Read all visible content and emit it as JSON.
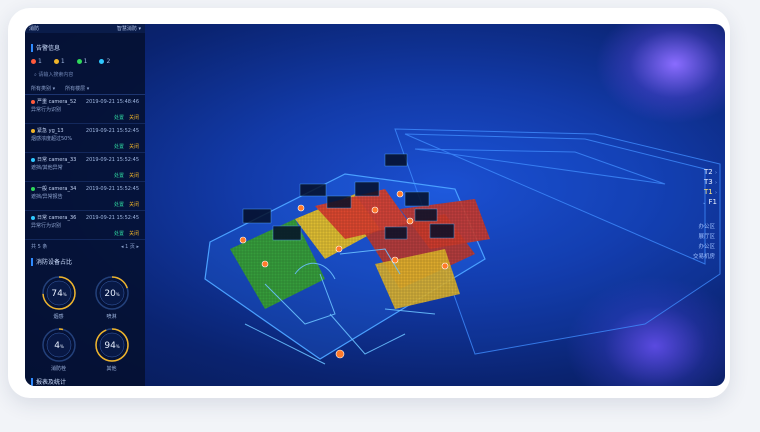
{
  "header": {
    "title": "消防",
    "dropdown": "智慧消防"
  },
  "alarm_section": {
    "title": "告警信息",
    "counts": [
      {
        "value": "1",
        "color": "#ff5a3c"
      },
      {
        "value": "1",
        "color": "#f0b429"
      },
      {
        "value": "1",
        "color": "#2fd95a"
      },
      {
        "value": "2",
        "color": "#2fc8ff"
      }
    ],
    "search_placeholder": "请输入搜索内容",
    "filter1": "所有类别",
    "filter2": "所有楼层",
    "items": [
      {
        "level": "严重",
        "device": "camera_52",
        "time": "2019-09-21 15:48:46",
        "desc": "异常行为识别",
        "act1": "处置",
        "act2": "关闭",
        "color": "#ff5a3c"
      },
      {
        "level": "紧急",
        "device": "yg_13",
        "time": "2019-09-21 15:52:45",
        "desc": "烟感浓度超过50%",
        "act1": "处置",
        "act2": "关闭",
        "color": "#f0b429"
      },
      {
        "level": "日常",
        "device": "camera_33",
        "time": "2019-09-21 15:52:45",
        "desc": "遮挡/其他异常",
        "act1": "处置",
        "act2": "关闭",
        "color": "#2fc8ff"
      },
      {
        "level": "一般",
        "device": "camera_34",
        "time": "2019-09-21 15:52:45",
        "desc": "遮挡/异常报告",
        "act1": "处置",
        "act2": "关闭",
        "color": "#2fd95a"
      },
      {
        "level": "日常",
        "device": "camera_36",
        "time": "2019-09-21 15:52:45",
        "desc": "异常行为识别",
        "act1": "处置",
        "act2": "关闭",
        "color": "#2fc8ff"
      }
    ],
    "pager_left": "共 5 条",
    "pager_right": "1  页"
  },
  "device_section": {
    "title": "消防设备占比",
    "gauges": [
      {
        "value": "74",
        "unit": "%",
        "label": "烟感",
        "fraction": 0.74,
        "color": "#f0b429"
      },
      {
        "value": "20",
        "unit": "%",
        "label": "喷淋",
        "fraction": 0.2,
        "color": "#f0b429"
      },
      {
        "value": "4",
        "unit": "%",
        "label": "消防栓",
        "fraction": 0.04,
        "color": "#f0b429"
      },
      {
        "value": "94",
        "unit": "%",
        "label": "其他",
        "fraction": 0.94,
        "color": "#f0b429"
      }
    ]
  },
  "bottom_section": {
    "title": "报表及统计"
  },
  "floors": {
    "items": [
      "T2",
      "T3",
      "T1",
      "F1"
    ],
    "active": "T1"
  },
  "zones": [
    "办公区",
    "展厅区",
    "办公区",
    "交易机房"
  ]
}
